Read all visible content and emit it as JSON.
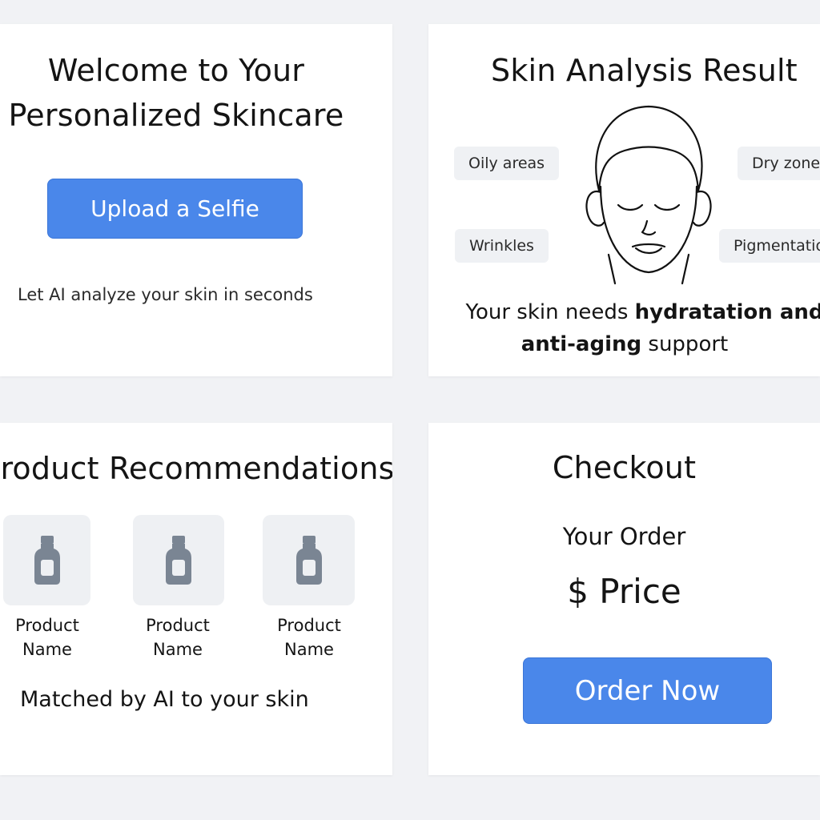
{
  "welcome": {
    "title_line1": "Welcome to Your",
    "title_line2": "Personalized Skincare",
    "upload_button": "Upload a Selfie",
    "subtitle": "Let AI analyze your skin in seconds"
  },
  "analysis": {
    "title": "Skin Analysis Result",
    "chips": [
      "Oily areas",
      "Dry zones",
      "Wrinkles",
      "Pigmentation"
    ],
    "summary_prefix": "Your skin needs ",
    "summary_bold1": "hydratation and",
    "summary_bold2": "anti-aging",
    "summary_suffix": " support"
  },
  "recommendations": {
    "title": "Product Recommendations",
    "products": [
      {
        "line1": "Product",
        "line2": "Name",
        "icon": "bottle-icon"
      },
      {
        "line1": "Product",
        "line2": "Name",
        "icon": "bottle-icon"
      },
      {
        "line1": "Product",
        "line2": "Name",
        "icon": "bottle-icon"
      }
    ],
    "caption": "Matched by AI to your skin"
  },
  "checkout": {
    "title": "Checkout",
    "order_label": "Your Order",
    "price": "$ Price",
    "order_button": "Order Now"
  },
  "colors": {
    "accent": "#4a87ea",
    "background": "#f1f2f5",
    "card": "#ffffff",
    "chip": "#eff1f4",
    "bottle": "#7a8593"
  }
}
